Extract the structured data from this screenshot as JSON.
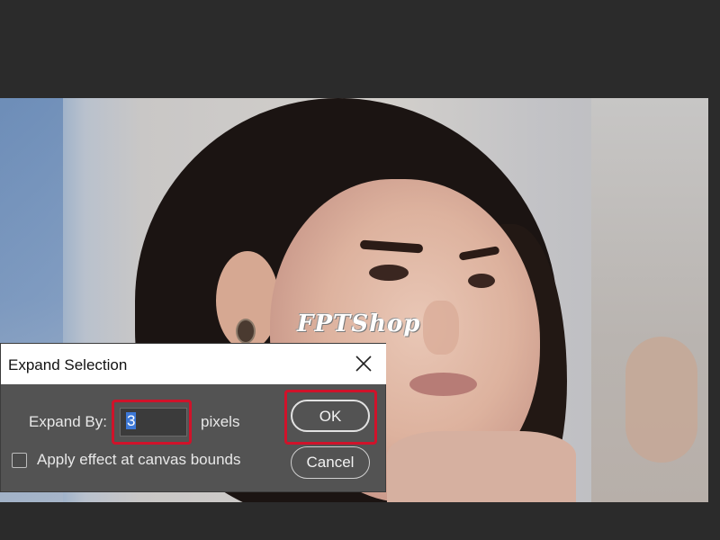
{
  "canvas": {
    "watermark": "FPTShop"
  },
  "dialog": {
    "title": "Expand Selection",
    "expand_label": "Expand By:",
    "expand_value": "3",
    "unit": "pixels",
    "ok_label": "OK",
    "cancel_label": "Cancel",
    "canvas_bounds_label": "Apply effect at canvas bounds",
    "canvas_bounds_checked": false,
    "highlight_color": "#d0122a",
    "selection_color": "#3d78d6"
  },
  "icons": {
    "close": "close-icon"
  }
}
